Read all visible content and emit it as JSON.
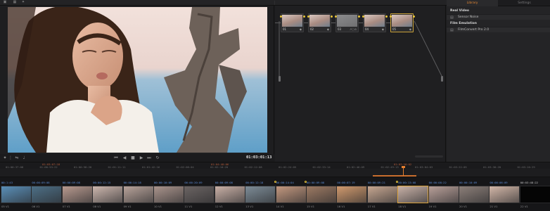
{
  "toolbar": {
    "icons": [
      "viewer-layout-icon",
      "grid-view-icon",
      "highlight-icon"
    ]
  },
  "viewer": {
    "timecode": "01:03:01:13",
    "controls": {
      "left": [
        "picker-icon",
        "split-icon",
        "shuffle-icon",
        "audio-icon"
      ],
      "transport": [
        "skip-start-icon",
        "step-back-icon",
        "stop-icon",
        "play-icon",
        "skip-end-icon",
        "loop-icon"
      ]
    }
  },
  "nodes": [
    {
      "num": "01",
      "ind": "◆",
      "grey": false,
      "selected": false
    },
    {
      "num": "02",
      "ind": "◆",
      "grey": false,
      "selected": false
    },
    {
      "num": "03",
      "ind": "↗○⊙",
      "grey": true,
      "selected": false
    },
    {
      "num": "04",
      "ind": "◆",
      "grey": false,
      "selected": false
    },
    {
      "num": "05",
      "ind": "◆",
      "grey": false,
      "selected": true
    }
  ],
  "library": {
    "tabs": [
      "Library",
      "Settings"
    ],
    "active_tab": "Library",
    "categories": [
      {
        "title": "Real Video",
        "items": [
          "Sensor Noise"
        ]
      },
      {
        "title": "Film Emulation",
        "items": [
          "FilmConvert Pro 2.0"
        ]
      }
    ]
  },
  "timeline": {
    "ruler": [
      "01:00:37:08",
      "01:00:53:22",
      "01:00:58:20",
      "01:01:11:11",
      "01:01:42:16",
      "01:02:08:04",
      "01:02:10:20",
      "01:02:12:08",
      "01:02:24:05",
      "01:02:33:14",
      "01:02:40:09",
      "01:02:49:13",
      "01:03:04:03",
      "01:03:22:05",
      "01:03:30:20",
      "01:03:10:29"
    ],
    "ruler_red": [
      "01:03:07:18",
      "01:04:40:06",
      "01:03:10:02"
    ]
  },
  "clips": [
    {
      "tc": "00:1:43",
      "num": "05",
      "v": "V1",
      "color": "#5a8fb8",
      "active": false,
      "flag": false
    },
    {
      "tc": "00:00:09:08",
      "num": "06",
      "v": "V1",
      "color": "#4d6f86",
      "active": false,
      "flag": false
    },
    {
      "tc": "00:00:09:08",
      "num": "07",
      "v": "V1",
      "color": "#b89a8f",
      "active": false,
      "flag": false
    },
    {
      "tc": "00:00:12:15",
      "num": "08",
      "v": "V1",
      "color": "#cdb7ae",
      "active": false,
      "flag": false
    },
    {
      "tc": "00:00:14:18",
      "num": "09",
      "v": "V1",
      "color": "#b8a39a",
      "active": false,
      "flag": false
    },
    {
      "tc": "00:00:10:09",
      "num": "10",
      "v": "V1",
      "color": "#aa948c",
      "active": false,
      "flag": false
    },
    {
      "tc": "00:00:20:09",
      "num": "11",
      "v": "V1",
      "color": "#6b6463",
      "active": false,
      "flag": false
    },
    {
      "tc": "00:00:09:08",
      "num": "12",
      "v": "V1",
      "color": "#c9b0a6",
      "active": false,
      "flag": false
    },
    {
      "tc": "00:00:12:18",
      "num": "13",
      "v": "V1",
      "color": "#7d8c97",
      "active": false,
      "flag": false
    },
    {
      "tc": "00:00:14:04",
      "num": "14",
      "v": "V1",
      "color": "#c3987f",
      "active": false,
      "flag": true
    },
    {
      "tc": "00:00:09:08",
      "num": "15",
      "v": "V1",
      "color": "#9d7a63",
      "active": false,
      "flag": true
    },
    {
      "tc": "00:00:07:19",
      "num": "16",
      "v": "V1",
      "color": "#d19a6e",
      "active": false,
      "flag": false
    },
    {
      "tc": "00:00:09:21",
      "num": "17",
      "v": "V1",
      "color": "#c7a791",
      "active": false,
      "flag": false
    },
    {
      "tc": "00:00:13:08",
      "num": "18",
      "v": "V1",
      "color": "#c8b1a7",
      "active": true,
      "flag": true
    },
    {
      "tc": "00:00:08:22",
      "num": "19",
      "v": "V1",
      "color": "#b9a099",
      "active": false,
      "flag": false
    },
    {
      "tc": "00:00:10:09",
      "num": "20",
      "v": "V1",
      "color": "#8c7f79",
      "active": false,
      "flag": false
    },
    {
      "tc": "00:00:06:09",
      "num": "21",
      "v": "V1",
      "color": "#d3b7a8",
      "active": false,
      "flag": false
    },
    {
      "tc": "00:03:48:22",
      "num": "22",
      "v": "V1",
      "color": "#050505",
      "active": false,
      "flag": false
    }
  ]
}
